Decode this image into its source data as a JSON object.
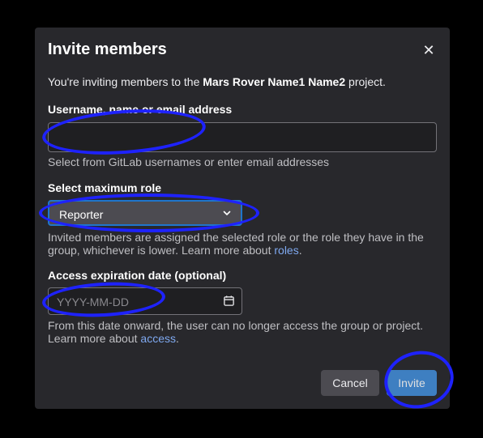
{
  "modal": {
    "title": "Invite members",
    "intro_prefix": "You're inviting members to the ",
    "project_name": "Mars Rover Name1 Name2",
    "intro_suffix": " project."
  },
  "username_field": {
    "label": "Username, name or email address",
    "value": "",
    "help": "Select from GitLab usernames or enter email addresses"
  },
  "role_field": {
    "label": "Select maximum role",
    "selected": "Reporter",
    "help_prefix": "Invited members are assigned the selected role or the role they have in the group, whichever is lower. Learn more about ",
    "help_link": "roles",
    "help_suffix": "."
  },
  "expiration_field": {
    "label": "Access expiration date (optional)",
    "placeholder": "YYYY-MM-DD",
    "help_prefix": "From this date onward, the user can no longer access the group or project. Learn more about ",
    "help_link": "access",
    "help_suffix": "."
  },
  "buttons": {
    "cancel": "Cancel",
    "invite": "Invite",
    "close_glyph": "✕"
  },
  "colors": {
    "modal_bg": "#28282c",
    "primary": "#428fdc",
    "annotation": "#1e22ff"
  },
  "icons": [
    "close-icon",
    "chevron-down-icon",
    "calendar-icon"
  ]
}
